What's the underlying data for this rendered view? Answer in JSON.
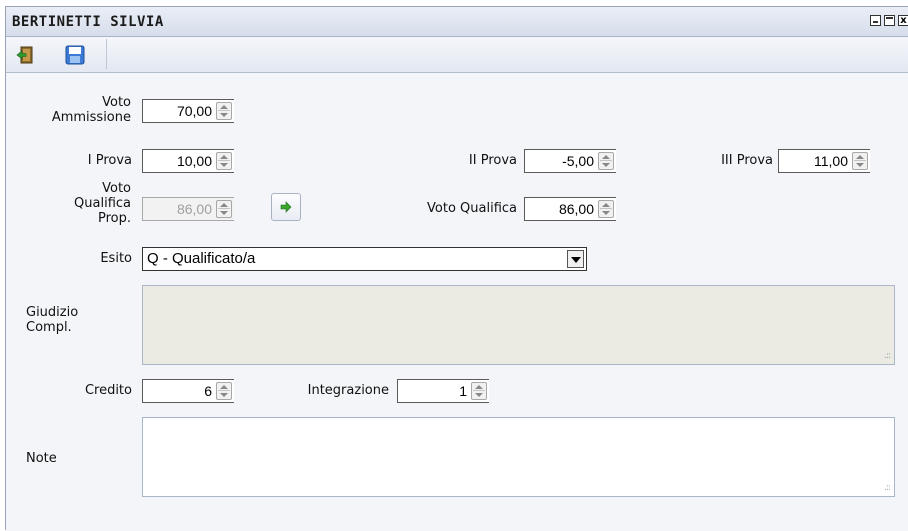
{
  "window": {
    "title": "BERTINETTI SILVIA",
    "close_glyph": "x"
  },
  "toolbar": {
    "exit_icon": "exit-door-icon",
    "save_icon": "floppy-save-icon"
  },
  "form": {
    "voto_ammissione": {
      "label_line1": "Voto",
      "label_line2": "Ammissione",
      "value": "70,00"
    },
    "prova_1": {
      "label": "I Prova",
      "value": "10,00"
    },
    "prova_2": {
      "label": "II Prova",
      "value": "-5,00"
    },
    "prova_3": {
      "label": "III Prova",
      "value": "11,00"
    },
    "voto_qualifica_prop": {
      "label_line1": "Voto",
      "label_line2": "Qualifica",
      "label_line3": "Prop.",
      "value": "86,00"
    },
    "copy_icon": "green-arrow-right-icon",
    "voto_qualifica": {
      "label": "Voto Qualifica",
      "value": "86,00"
    },
    "esito": {
      "label": "Esito",
      "value": "Q - Qualificato/a"
    },
    "giudizio": {
      "label_line1": "Giudizio",
      "label_line2": "Compl.",
      "value": ""
    },
    "credito": {
      "label": "Credito",
      "value": "6"
    },
    "integrazione": {
      "label": "Integrazione",
      "value": "1"
    },
    "note": {
      "label": "Note",
      "value": ""
    }
  },
  "colors": {
    "titlebar": "#d6deeb",
    "form_bg": "#f3f5f9",
    "giudizio_bg": "#ebeae3",
    "arrow_green": "#3aa52b"
  }
}
